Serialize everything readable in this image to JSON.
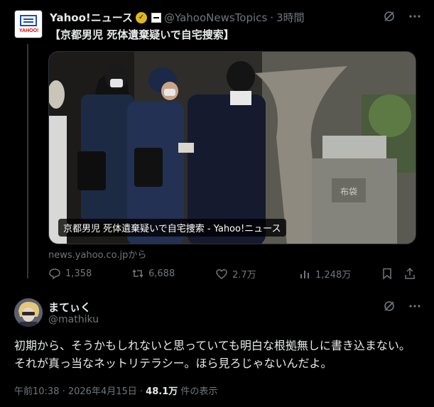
{
  "main_post": {
    "author_name": "Yahoo!ニュース",
    "handle": "@YahooNewsTopics",
    "separator": "·",
    "time": "3時間",
    "avatar_label": "YAHOO!",
    "text": "【京都男児 死体遺棄疑いで自宅捜索】",
    "media": {
      "caption": "京都男児 死体遺棄疑いで自宅捜索 - Yahoo!ニュース",
      "source": "news.yahoo.co.jpから",
      "scene_sign": "布袋"
    },
    "actions": {
      "replies": "1,358",
      "reposts": "6,688",
      "likes": "2.7万",
      "views": "1,248万"
    }
  },
  "reply": {
    "author_name": "まてぃく",
    "handle": "@mathiku",
    "text": "初期から、そうかもしれないと思っていても明白な根拠無しに書き込まない。それが真っ当なネットリテラシー。ほら見ろじゃないんだよ。",
    "timestamp": "午前10:38 · 2026年4月15日 ·",
    "views_count": "48.1万",
    "views_label": "件の表示"
  },
  "icons": {
    "verified": "verified-badge-icon",
    "affiliate": "affiliate-badge-icon",
    "grok": "grok-icon",
    "more": "more-icon",
    "reply": "reply-icon",
    "repost": "repost-icon",
    "like": "like-icon",
    "views": "views-icon",
    "bookmark": "bookmark-icon",
    "share": "share-icon"
  },
  "colors": {
    "background": "#000000",
    "text": "#e7e9ea",
    "muted": "#71767b",
    "verified_gold": "#e2b719"
  }
}
